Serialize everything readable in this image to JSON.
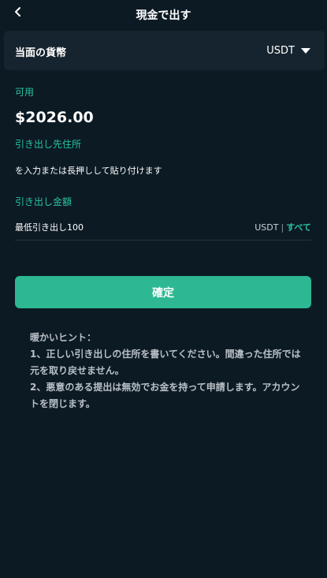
{
  "header": {
    "back_icon": "chevron-left-icon",
    "title": "現金で出す"
  },
  "currency": {
    "label": "当面の貨幣",
    "value": "USDT",
    "dropdown_icon": "caret-down-icon"
  },
  "available": {
    "label": "可用",
    "balance": "$2026.00"
  },
  "address": {
    "label": "引き出し先住所",
    "placeholder": "を入力または長押しして貼り付けます"
  },
  "amount": {
    "label": "引き出し金額",
    "placeholder": "最低引き出し100",
    "currency": "USDT",
    "separator": "|",
    "all_label": "すべて"
  },
  "confirm_button": "確定",
  "hint": {
    "title": "暖かいヒント：",
    "line1": "1、正しい引き出しの住所を書いてください。間違った住所では元を取り戻せません。",
    "line2": "2、悪意のある提出は無効でお金を持って申請します。アカウントを閉じます。"
  },
  "colors": {
    "background": "#0c1a24",
    "panel": "#16242f",
    "accent": "#27c3a0",
    "button": "#2db893"
  }
}
